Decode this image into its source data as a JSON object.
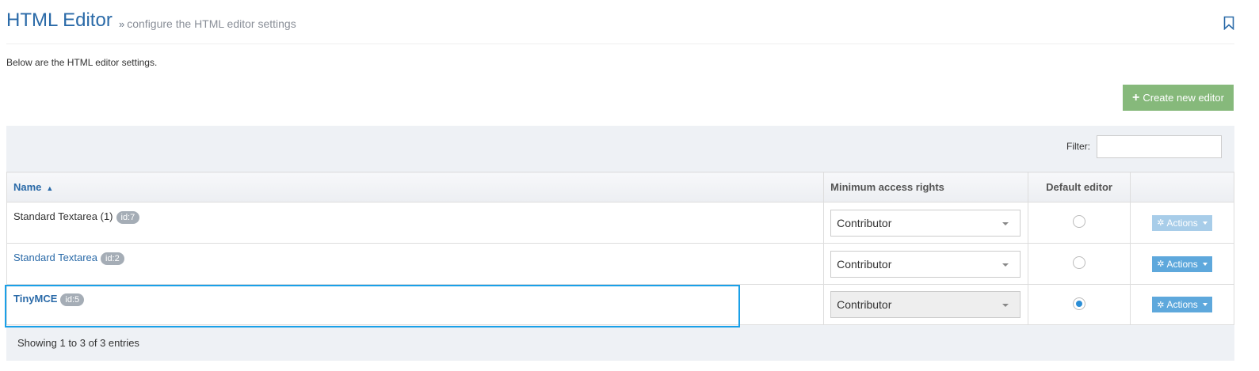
{
  "header": {
    "title": "HTML Editor",
    "subtitle_chevron": "»",
    "subtitle": "configure the HTML editor settings"
  },
  "intro": "Below are the HTML editor settings.",
  "create_button": {
    "label": "Create new editor",
    "icon": "plus-icon"
  },
  "filter": {
    "label": "Filter:",
    "value": ""
  },
  "table": {
    "columns": {
      "name": "Name",
      "access": "Minimum access rights",
      "default": "Default editor",
      "actions": ""
    },
    "rows": [
      {
        "name": "Standard Textarea (1)",
        "id": "id:7",
        "access": "Contributor",
        "default": false,
        "actions": "Actions"
      },
      {
        "name": "Standard Textarea",
        "id": "id:2",
        "access": "Contributor",
        "default": false,
        "actions": "Actions"
      },
      {
        "name": "TinyMCE",
        "id": "id:5",
        "access": "Contributor",
        "default": true,
        "actions": "Actions"
      }
    ]
  },
  "footer": {
    "showing": "Showing 1 to 3 of 3 entries"
  },
  "colors": {
    "title": "#2a6aa8",
    "create_button": "#86b97b",
    "actions_button": "#5ea8dc",
    "highlight": "#1aa0e8"
  }
}
